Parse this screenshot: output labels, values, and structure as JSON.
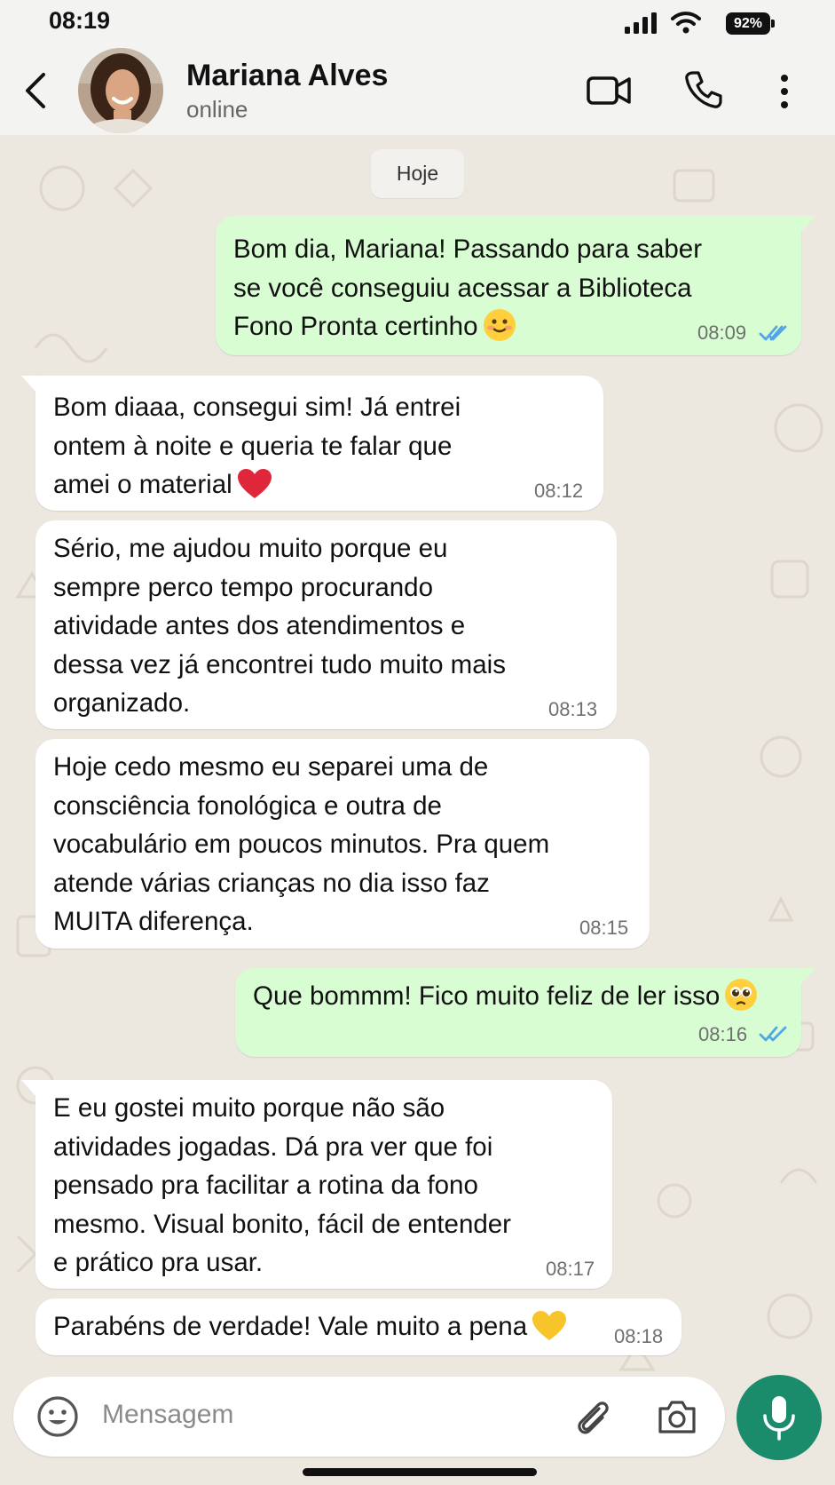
{
  "status_bar": {
    "time": "08:19",
    "battery": "92%"
  },
  "header": {
    "contact_name": "Mariana Alves",
    "contact_status": "online"
  },
  "chat": {
    "date_chip": "Hoje",
    "messages": [
      {
        "direction": "outgoing",
        "text": "Bom dia, Mariana! Passando para saber\nse você conseguiu acessar a Biblioteca\nFono Pronta certinho",
        "emoji": "smiling-face",
        "time": "08:09",
        "status": "read"
      },
      {
        "direction": "incoming",
        "text": "Bom diaaa, consegui sim! Já entrei\nontem à noite e queria te falar que\namei o material",
        "emoji": "red-heart",
        "time": "08:12"
      },
      {
        "direction": "incoming",
        "text": "Sério, me ajudou muito porque eu\nsempre perco tempo procurando\natividade antes dos atendimentos e\ndessa vez já encontrei tudo muito mais\norganizado.",
        "time": "08:13"
      },
      {
        "direction": "incoming",
        "text": "Hoje cedo mesmo eu separei uma de\nconsciência fonológica e outra de\nvocabulário em poucos minutos. Pra quem\natende várias crianças no dia isso faz\nMUITA diferença.",
        "time": "08:15"
      },
      {
        "direction": "outgoing",
        "text": "Que bommm! Fico muito feliz de ler isso",
        "emoji": "pleading-face",
        "time": "08:16",
        "status": "read"
      },
      {
        "direction": "incoming",
        "text": "E eu gostei muito porque não são\natividades jogadas. Dá pra ver que foi\npensado pra facilitar a rotina da fono\nmesmo. Visual bonito, fácil de entender\ne prático pra usar.",
        "time": "08:17"
      },
      {
        "direction": "incoming",
        "text": "Parabéns de verdade! Vale muito a pena",
        "emoji": "yellow-heart",
        "time": "08:18"
      }
    ]
  },
  "input": {
    "placeholder": "Mensagem"
  },
  "colors": {
    "outgoing_bubble": "#d9fdd3",
    "incoming_bubble": "#ffffff",
    "chat_background": "#ece7df",
    "accent_green": "#1a8b6b",
    "read_ticks": "#53a6e6"
  }
}
